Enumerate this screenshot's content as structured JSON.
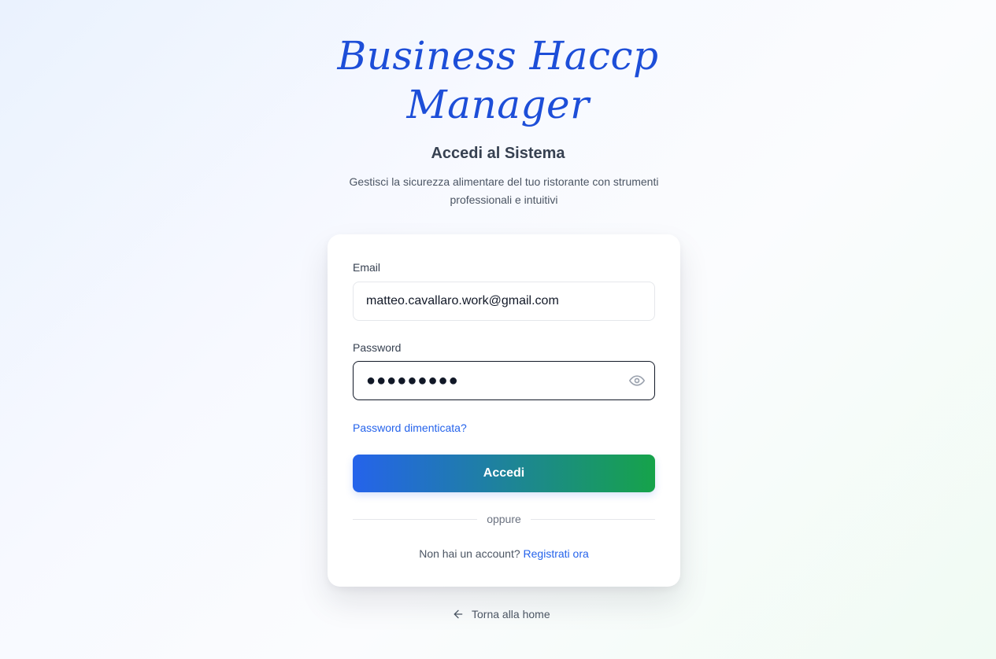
{
  "brand": {
    "line1": "Business Haccp",
    "line2": "Manager"
  },
  "login": {
    "heading": "Accedi al Sistema",
    "subtitle": "Gestisci la sicurezza alimentare del tuo ristorante con strumenti professionali e intuitivi"
  },
  "form": {
    "email_label": "Email",
    "email_value": "matteo.cavallaro.work@gmail.com",
    "password_label": "Password",
    "password_value": "●●●●●●●●●",
    "forgot_label": "Password dimenticata?",
    "submit_label": "Accedi",
    "divider_label": "oppure",
    "signup_prompt": "Non hai un account?",
    "signup_link": "Registrati ora"
  },
  "footer": {
    "back_label": "Torna alla home"
  },
  "icons": {
    "password_toggle": "eye-icon",
    "back": "arrow-left-icon"
  },
  "colors": {
    "brand": "#1d4ed8",
    "link": "#2563eb",
    "button_gradient_start": "#2563eb",
    "button_gradient_end": "#16a34a"
  }
}
